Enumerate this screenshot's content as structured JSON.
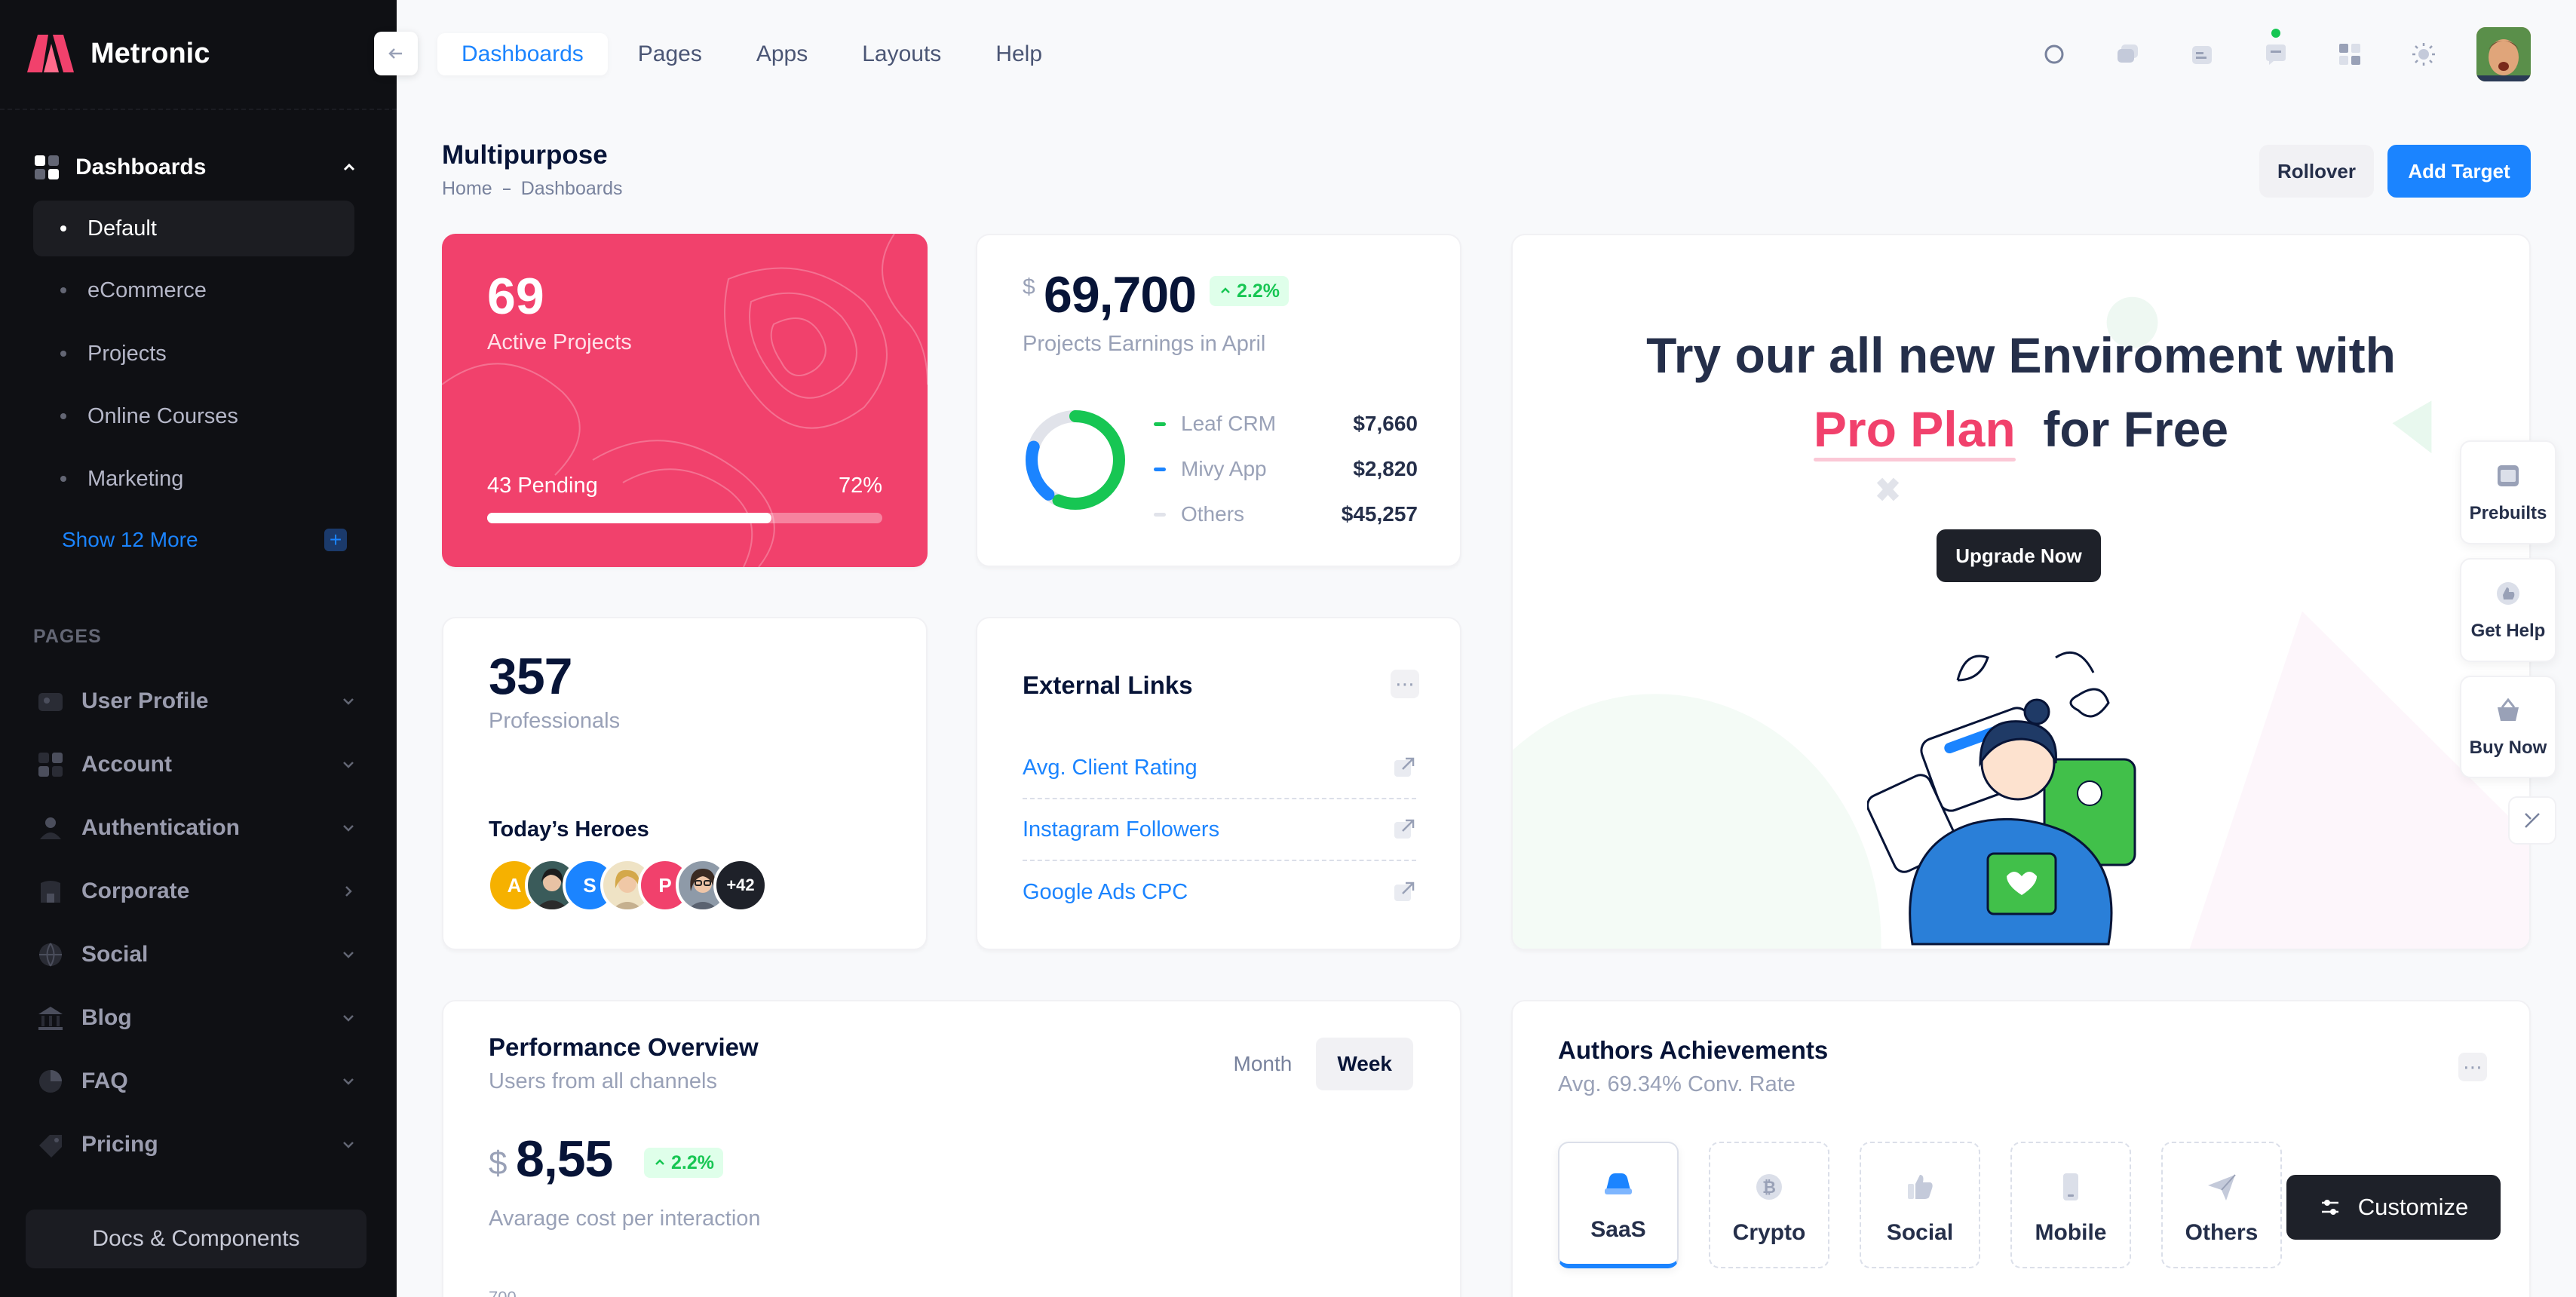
{
  "sidebar": {
    "brand": "Metronic",
    "dashboards": {
      "label": "Dashboards",
      "items": [
        {
          "label": "Default"
        },
        {
          "label": "eCommerce"
        },
        {
          "label": "Projects"
        },
        {
          "label": "Online Courses"
        },
        {
          "label": "Marketing"
        }
      ],
      "show_more": "Show 12 More"
    },
    "pages_heading": "PAGES",
    "sections": [
      {
        "label": "User Profile"
      },
      {
        "label": "Account"
      },
      {
        "label": "Authentication"
      },
      {
        "label": "Corporate"
      },
      {
        "label": "Social"
      },
      {
        "label": "Blog"
      },
      {
        "label": "FAQ"
      },
      {
        "label": "Pricing"
      }
    ],
    "docs_button": "Docs & Components"
  },
  "topnav": {
    "items": [
      {
        "label": "Dashboards"
      },
      {
        "label": "Pages"
      },
      {
        "label": "Apps"
      },
      {
        "label": "Layouts"
      },
      {
        "label": "Help"
      }
    ]
  },
  "toolbar": {
    "title": "Multipurpose",
    "breadcrumb": [
      "Home",
      "Dashboards"
    ],
    "rollover": "Rollover",
    "add_target": "Add Target"
  },
  "projects_card": {
    "count": "69",
    "label": "Active Projects",
    "pending": "43 Pending",
    "percent_label": "72%",
    "progress": 0.72,
    "color": "#f1416c"
  },
  "earnings_card": {
    "currency": "$",
    "amount": "69,700",
    "change": "2.2%",
    "label": "Projects Earnings in April",
    "legend": [
      {
        "name": "Leaf CRM",
        "value": "$7,660",
        "color": "#17c653"
      },
      {
        "name": "Mivy App",
        "value": "$2,820",
        "color": "#1b84ff"
      },
      {
        "name": "Others",
        "value": "$45,257",
        "color": "#e1e3ea"
      }
    ]
  },
  "promo_card": {
    "line1": "Try our all new Enviroment with",
    "highlight": "Pro Plan",
    "line2_rest": "for Free",
    "button": "Upgrade Now"
  },
  "professionals_card": {
    "count": "357",
    "label": "Professionals",
    "heroes_title": "Today’s Heroes",
    "avatars": [
      "A",
      "",
      "S",
      "",
      "P",
      "",
      "+42"
    ]
  },
  "links_card": {
    "title": "External Links",
    "links": [
      {
        "label": "Avg. Client Rating"
      },
      {
        "label": "Instagram Followers"
      },
      {
        "label": "Google Ads CPC"
      }
    ]
  },
  "performance_card": {
    "title": "Performance Overview",
    "subtitle": "Users from all channels",
    "tab_month": "Month",
    "tab_week": "Week",
    "currency": "$",
    "amount": "8,55",
    "change": "2.2%",
    "label": "Avarage cost per interaction",
    "axis_top": "700"
  },
  "authors_card": {
    "title": "Authors Achievements",
    "subtitle": "Avg. 69.34% Conv. Rate",
    "tabs": [
      {
        "label": "SaaS"
      },
      {
        "label": "Crypto"
      },
      {
        "label": "Social"
      },
      {
        "label": "Mobile"
      },
      {
        "label": "Others"
      }
    ]
  },
  "floating": {
    "prebuilts": "Prebuilts",
    "get_help": "Get Help",
    "buy_now": "Buy Now",
    "customize": "Customize"
  },
  "colors": {
    "primary": "#1b84ff",
    "danger": "#f1416c",
    "success": "#17c653",
    "sidebar_bg": "#0f1014"
  }
}
